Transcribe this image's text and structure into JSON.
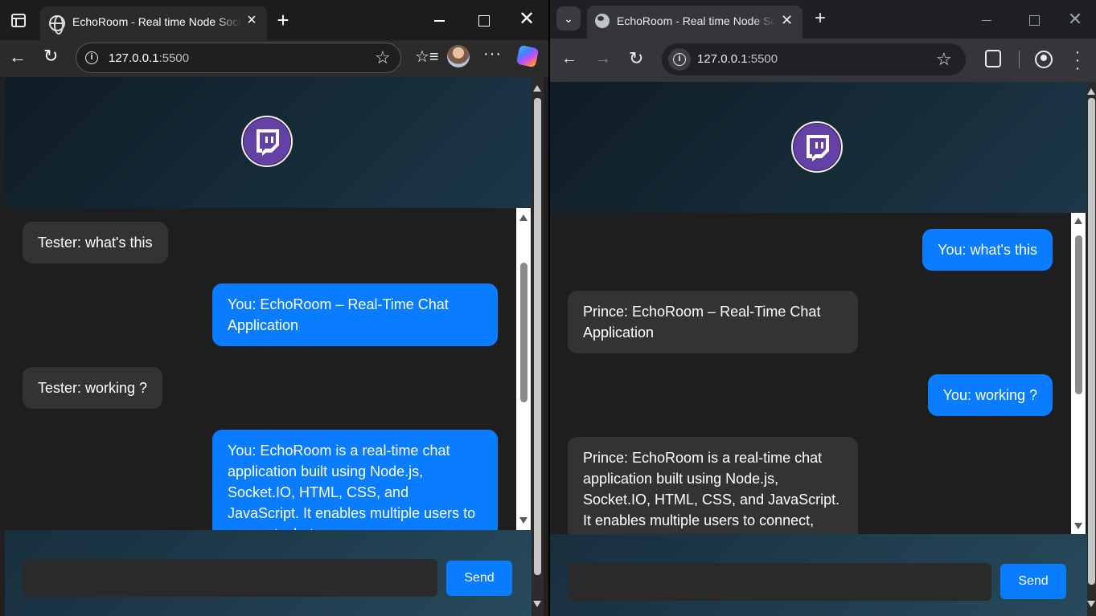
{
  "left_browser": {
    "tab_title": "EchoRoom - Real time Node Socket.IO Chat",
    "url_host": "127.0.0.1",
    "url_port": ":5500",
    "icons": [
      "tab-actions-icon",
      "globe-icon",
      "close-icon",
      "plus-icon",
      "minimize-icon",
      "maximize-icon",
      "back-icon",
      "reload-icon",
      "info-icon",
      "star-icon",
      "favorites-icon",
      "avatar",
      "more-icon",
      "copilot-icon"
    ]
  },
  "right_browser": {
    "tab_title": "EchoRoom - Real time Node Socket.IO Chat",
    "url_host": "127.0.0.1",
    "url_port": ":5500",
    "icons": [
      "chevron-down-icon",
      "globe-icon",
      "close-icon",
      "plus-icon",
      "back-icon",
      "forward-icon",
      "reload-icon",
      "info-icon",
      "star-icon",
      "extensions-icon",
      "profile-icon",
      "menu-icon"
    ]
  },
  "app": {
    "logo_icon": "twitch-icon",
    "accent_color": "#0a7cff",
    "logo_color": "#6441a5",
    "send_label": "Send",
    "input_value": ""
  },
  "left_chat": {
    "messages": [
      {
        "sender": "other",
        "text": "Tester: what's this"
      },
      {
        "sender": "self",
        "text": "You: EchoRoom – Real-Time Chat Application"
      },
      {
        "sender": "other",
        "text": "Tester: working ?"
      },
      {
        "sender": "self",
        "text": "You: EchoRoom is a real-time chat application built using Node.js, Socket.IO, HTML, CSS, and JavaScript. It enables multiple users to connect, chat"
      }
    ]
  },
  "right_chat": {
    "messages": [
      {
        "sender": "self",
        "text": "You: what's this"
      },
      {
        "sender": "other",
        "text": "Prince: EchoRoom – Real-Time Chat Application"
      },
      {
        "sender": "self",
        "text": "You: working ?"
      },
      {
        "sender": "other",
        "text": "Prince: EchoRoom is a real-time chat application built using Node.js, Socket.IO, HTML, CSS, and JavaScript. It enables multiple users to connect,"
      }
    ]
  }
}
